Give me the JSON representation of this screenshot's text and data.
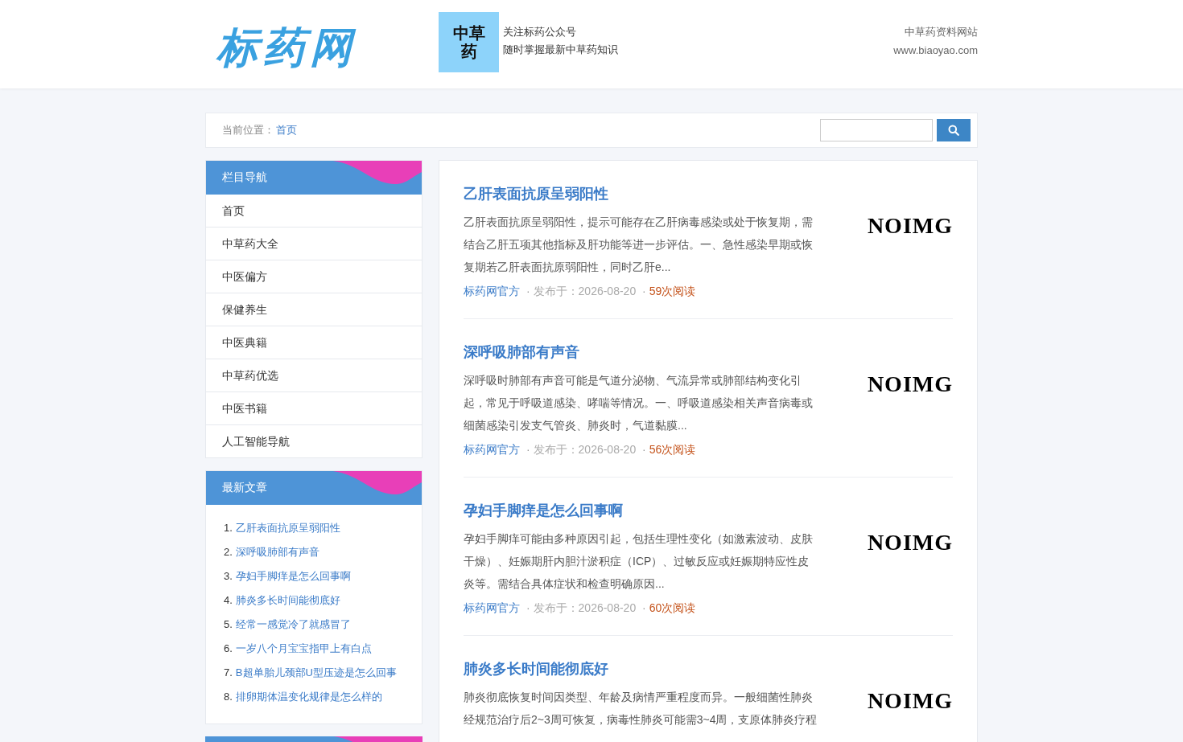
{
  "header": {
    "logo": "标药网",
    "qr_label": "中草药",
    "follow_lines": [
      "关注标药公众号",
      "随时掌握最新中草药知识"
    ],
    "site_lines": [
      "中草药资料网站",
      "www.biaoyao.com"
    ]
  },
  "breadcrumb": {
    "label": "当前位置：",
    "link": "首页"
  },
  "nav_panel": {
    "title": "栏目导航",
    "items": [
      {
        "label": "首页"
      },
      {
        "label": "中草药大全"
      },
      {
        "label": "中医偏方"
      },
      {
        "label": "保健养生"
      },
      {
        "label": "中医典籍"
      },
      {
        "label": "中草药优选"
      },
      {
        "label": "中医书籍"
      },
      {
        "label": "人工智能导航"
      }
    ]
  },
  "latest_panel": {
    "title": "最新文章",
    "items": [
      {
        "number": "1.",
        "title": "乙肝表面抗原呈弱阳性"
      },
      {
        "number": "2.",
        "title": "深呼吸肺部有声音"
      },
      {
        "number": "3.",
        "title": "孕妇手脚痒是怎么回事啊"
      },
      {
        "number": "4.",
        "title": "肺炎多长时间能彻底好"
      },
      {
        "number": "5.",
        "title": "经常一感觉冷了就感冒了"
      },
      {
        "number": "6.",
        "title": "一岁八个月宝宝指甲上有白点"
      },
      {
        "number": "7.",
        "title": "B超单胎儿颈部U型压迹是怎么回事"
      },
      {
        "number": "8.",
        "title": "排卵期体温变化规律是怎么样的"
      }
    ]
  },
  "articles": [
    {
      "title": "乙肝表面抗原呈弱阳性",
      "summary": "乙肝表面抗原呈弱阳性，提示可能存在乙肝病毒感染或处于恢复期，需结合乙肝五项其他指标及肝功能等进一步评估。一、急性感染早期或恢复期若乙肝表面抗原弱阳性，同时乙肝e...",
      "author": "标药网官方",
      "separator": "·",
      "date": "发布于：2026-08-20",
      "reads": "59次阅读",
      "thumbnail": "NOIMG"
    },
    {
      "title": "深呼吸肺部有声音",
      "summary": "深呼吸时肺部有声音可能是气道分泌物、气流异常或肺部结构变化引起，常见于呼吸道感染、哮喘等情况。一、呼吸道感染相关声音病毒或细菌感染引发支气管炎、肺炎时，气道黏膜...",
      "author": "标药网官方",
      "separator": "·",
      "date": "发布于：2026-08-20",
      "reads": "56次阅读",
      "thumbnail": "NOIMG"
    },
    {
      "title": "孕妇手脚痒是怎么回事啊",
      "summary": "孕妇手脚痒可能由多种原因引起，包括生理性变化（如激素波动、皮肤干燥）、妊娠期肝内胆汁淤积症（ICP）、过敏反应或妊娠期特应性皮炎等。需结合具体症状和检查明确原因...",
      "author": "标药网官方",
      "separator": "·",
      "date": "发布于：2026-08-20",
      "reads": "60次阅读",
      "thumbnail": "NOIMG"
    },
    {
      "title": "肺炎多长时间能彻底好",
      "summary": "肺炎彻底恢复时间因类型、年龄及病情严重程度而异。一般细菌性肺炎经规范治疗后2~3周可恢复，病毒性肺炎可能需3~4周，支原体肺炎疗程",
      "thumbnail": "NOIMG"
    }
  ]
}
